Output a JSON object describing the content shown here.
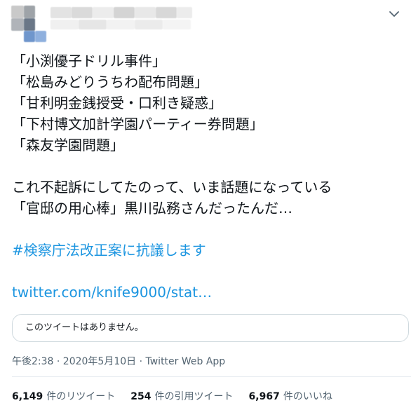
{
  "tweet": {
    "lines": [
      "「小渕優子ドリル事件」",
      "「松島みどりうちわ配布問題」",
      "「甘利明金銭授受・口利き疑惑」",
      "「下村博文加計学園パーティー券問題」",
      "「森友学園問題」",
      "",
      "これ不起訴にしてたのって、いま話題になっている",
      "「官邸の用心棒」黒川弘務さんだったんだ…"
    ],
    "hashtag": "#検察庁法改正案に抗議します",
    "link": "twitter.com/knife9000/stat…"
  },
  "quoted_tweet": {
    "text": "このツイートはありません。"
  },
  "meta": {
    "timestamp": "午後2:38 · 2020年5月10日 · Twitter Web App"
  },
  "stats": [
    {
      "count": "6,149",
      "label": "件のリツイート"
    },
    {
      "count": "254",
      "label": "件の引用ツイート"
    },
    {
      "count": "6,967",
      "label": "件のいいね"
    }
  ],
  "icons": {
    "menu": "chevron-down-icon"
  }
}
